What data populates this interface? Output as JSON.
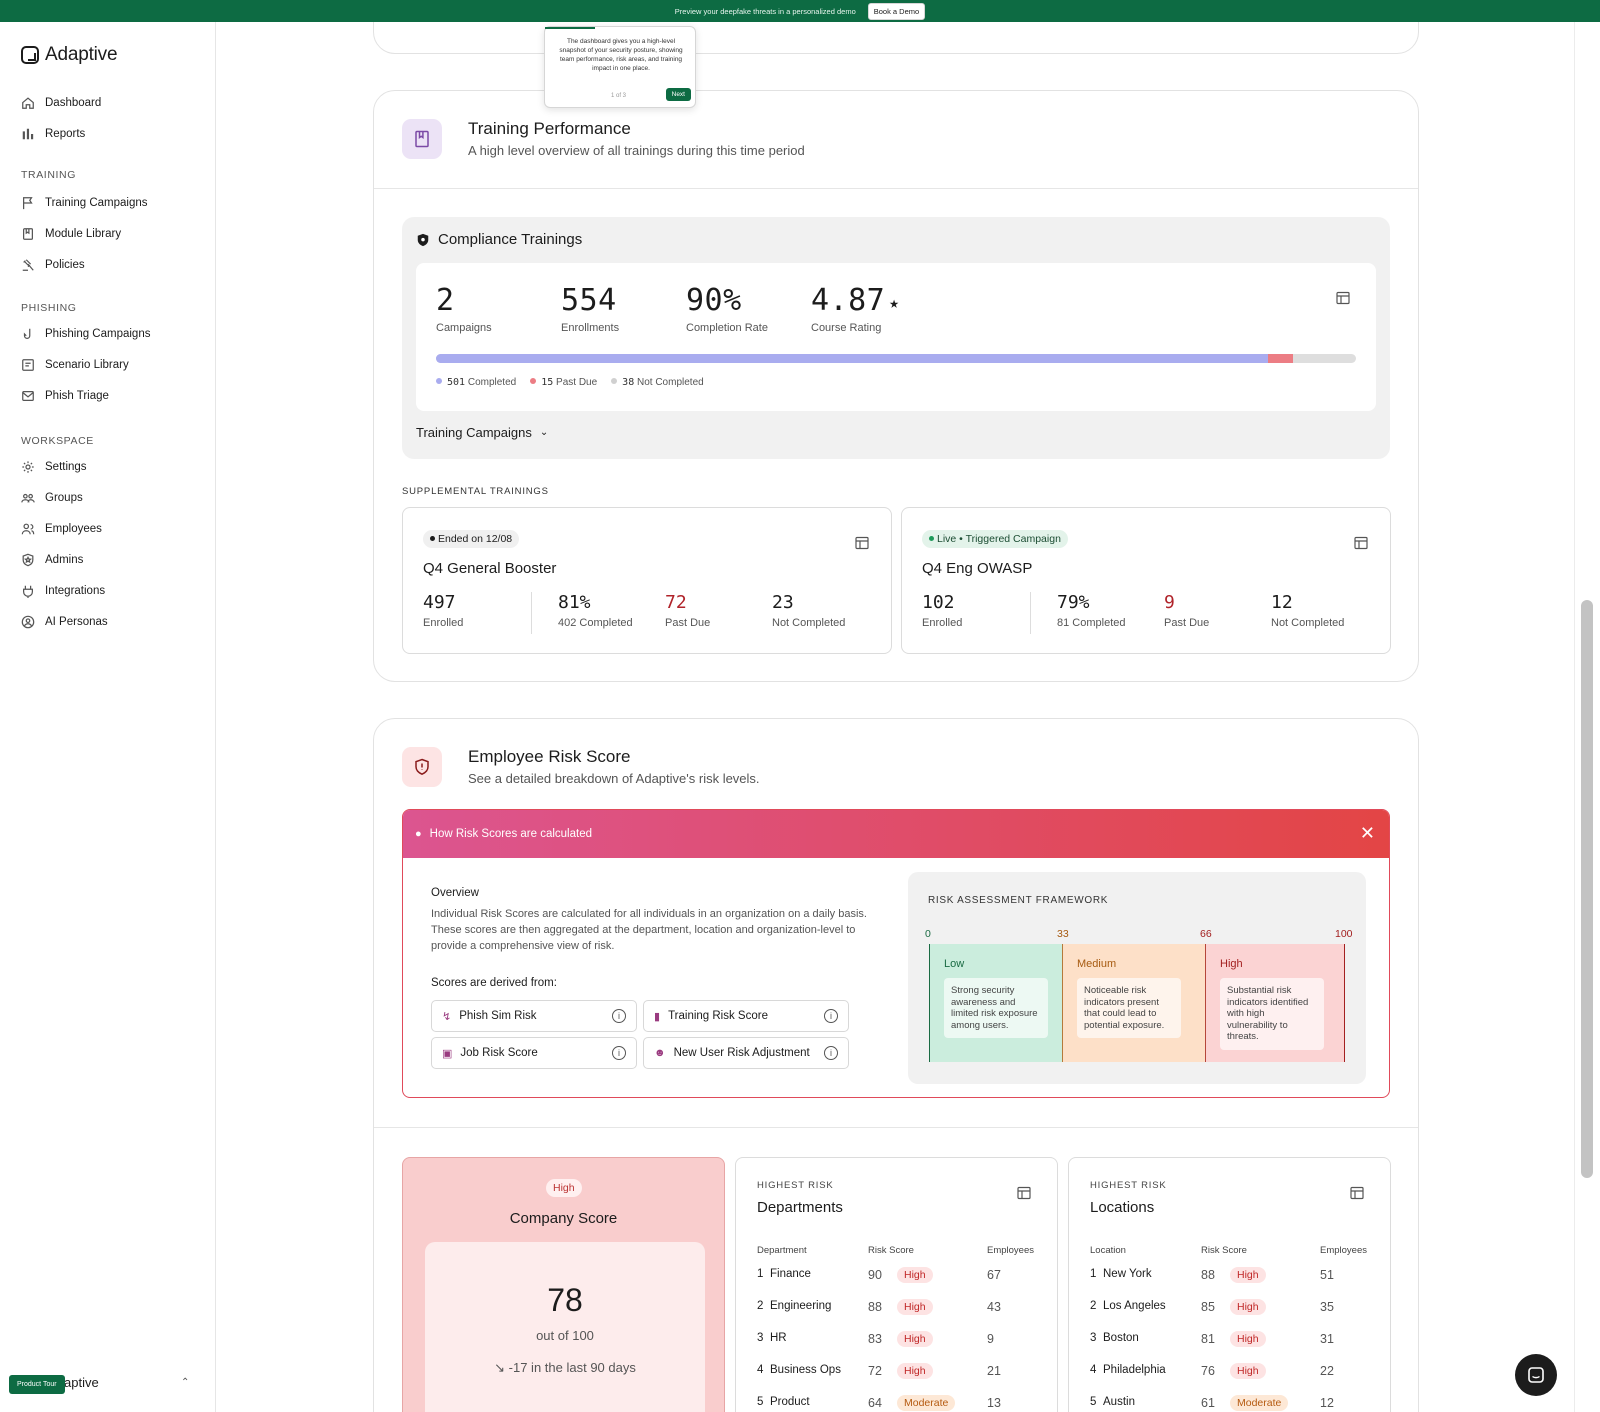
{
  "banner": {
    "text": "Preview your deepfake threats in a personalized demo",
    "button": "Book a Demo"
  },
  "brand": {
    "name": "Adaptive"
  },
  "sidebar": {
    "top": [
      {
        "label": "Dashboard",
        "icon": "home-icon"
      },
      {
        "label": "Reports",
        "icon": "bar-chart-icon"
      }
    ],
    "training": {
      "label": "TRAINING",
      "items": [
        {
          "label": "Training Campaigns",
          "icon": "flag-icon"
        },
        {
          "label": "Module Library",
          "icon": "book-icon"
        },
        {
          "label": "Policies",
          "icon": "gavel-icon"
        }
      ]
    },
    "phishing": {
      "label": "PHISHING",
      "items": [
        {
          "label": "Phishing Campaigns",
          "icon": "hook-icon"
        },
        {
          "label": "Scenario Library",
          "icon": "document-icon"
        },
        {
          "label": "Phish Triage",
          "icon": "mail-icon"
        }
      ]
    },
    "workspace": {
      "label": "WORKSPACE",
      "items": [
        {
          "label": "Settings",
          "icon": "gear-icon"
        },
        {
          "label": "Groups",
          "icon": "users-icon"
        },
        {
          "label": "Employees",
          "icon": "user-icon"
        },
        {
          "label": "Admins",
          "icon": "shield-star-icon"
        },
        {
          "label": "Integrations",
          "icon": "plug-icon"
        },
        {
          "label": "AI Personas",
          "icon": "persona-icon"
        }
      ]
    },
    "product_tour": "Product Tour",
    "footer_text": "aptive"
  },
  "tooltip": {
    "text": "The dashboard gives you a high-level snapshot of your security posture, showing team performance, risk areas, and training impact in one place.",
    "step": "1 of 3",
    "next": "Next"
  },
  "training_performance": {
    "title": "Training Performance",
    "subtitle": "A high level overview of all trainings during this time period",
    "compliance": {
      "title": "Compliance Trainings",
      "stats": [
        {
          "value": "2",
          "label": "Campaigns"
        },
        {
          "value": "554",
          "label": "Enrollments"
        },
        {
          "value": "90%",
          "label": "Completion Rate"
        },
        {
          "value": "4.87",
          "label": "Course Rating"
        }
      ],
      "progress": {
        "completed": 501,
        "past_due": 15,
        "not_completed": 38,
        "total": 554
      },
      "legend": [
        {
          "value": "501",
          "label": "Completed",
          "color": "#a9acef"
        },
        {
          "value": "15",
          "label": "Past Due",
          "color": "#ec7d84"
        },
        {
          "value": "38",
          "label": "Not Completed",
          "color": "#dedede"
        }
      ],
      "campaigns_toggle": "Training Campaigns"
    },
    "supplemental_label": "SUPPLEMENTAL TRAININGS",
    "supplemental": [
      {
        "status": "Ended on 12/08",
        "title": "Q4 General Booster",
        "enrolled": "497",
        "enrolled_label": "Enrolled",
        "completion": "81%",
        "completion_label": "402 Completed",
        "past_due": "72",
        "past_due_label": "Past Due",
        "not_completed": "23",
        "not_completed_label": "Not Completed"
      },
      {
        "status": "Live • Triggered Campaign",
        "title": "Q4 Eng OWASP",
        "enrolled": "102",
        "enrolled_label": "Enrolled",
        "completion": "79%",
        "completion_label": "81 Completed",
        "past_due": "9",
        "past_due_label": "Past Due",
        "not_completed": "12",
        "not_completed_label": "Not Completed"
      }
    ]
  },
  "risk": {
    "title": "Employee Risk Score",
    "subtitle": "See a detailed breakdown of Adaptive's risk levels.",
    "banner_title": "How Risk Scores are calculated",
    "overview_title": "Overview",
    "overview_text": "Individual Risk Scores are calculated for all individuals in an organization on a daily basis. These scores are then aggregated at the department, location and organization-level to provide a comprehensive view of risk.",
    "derived_label": "Scores are derived from:",
    "factors": [
      "Phish Sim Risk",
      "Training Risk Score",
      "Job Risk Score",
      "New User Risk Adjustment"
    ],
    "framework": {
      "title": "RISK ASSESSMENT FRAMEWORK",
      "ticks": [
        "0",
        "33",
        "66",
        "100"
      ],
      "bands": [
        {
          "name": "Low",
          "desc": "Strong security awareness and limited risk exposure among users."
        },
        {
          "name": "Medium",
          "desc": "Noticeable risk indicators present that could lead to potential exposure."
        },
        {
          "name": "High",
          "desc": "Substantial risk indicators identified with high vulnerability to threats."
        }
      ]
    },
    "company": {
      "level": "High",
      "title": "Company Score",
      "score": "78",
      "out_of": "out of 100",
      "trend": "-17 in the last 90 days"
    },
    "departments": {
      "kicker": "HIGHEST RISK",
      "title": "Departments",
      "headers": [
        "Department",
        "Risk Score",
        "Employees"
      ],
      "rows": [
        {
          "rank": "1",
          "name": "Finance",
          "score": "90",
          "level": "High",
          "employees": "67"
        },
        {
          "rank": "2",
          "name": "Engineering",
          "score": "88",
          "level": "High",
          "employees": "43"
        },
        {
          "rank": "3",
          "name": "HR",
          "score": "83",
          "level": "High",
          "employees": "9"
        },
        {
          "rank": "4",
          "name": "Business Ops",
          "score": "72",
          "level": "High",
          "employees": "21"
        },
        {
          "rank": "5",
          "name": "Product",
          "score": "64",
          "level": "Moderate",
          "employees": "13"
        }
      ]
    },
    "locations": {
      "kicker": "HIGHEST RISK",
      "title": "Locations",
      "headers": [
        "Location",
        "Risk Score",
        "Employees"
      ],
      "rows": [
        {
          "rank": "1",
          "name": "New York",
          "score": "88",
          "level": "High",
          "employees": "51"
        },
        {
          "rank": "2",
          "name": "Los Angeles",
          "score": "85",
          "level": "High",
          "employees": "35"
        },
        {
          "rank": "3",
          "name": "Boston",
          "score": "81",
          "level": "High",
          "employees": "31"
        },
        {
          "rank": "4",
          "name": "Philadelphia",
          "score": "76",
          "level": "High",
          "employees": "22"
        },
        {
          "rank": "5",
          "name": "Austin",
          "score": "61",
          "level": "Moderate",
          "employees": "12"
        }
      ]
    }
  }
}
